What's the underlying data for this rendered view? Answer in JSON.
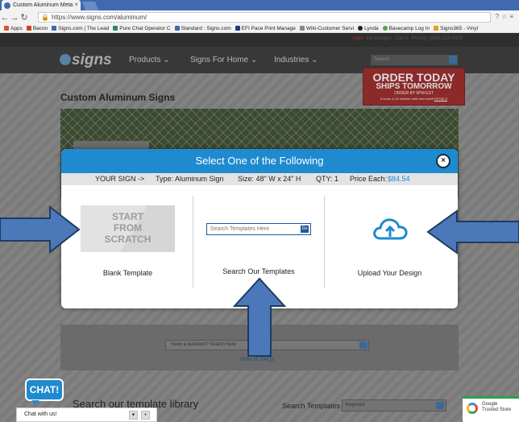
{
  "browser": {
    "tab_title": "Custom Aluminum Meta",
    "tab_close": "×",
    "url": "https://www.signs.com/aluminum/",
    "bookmarks": [
      "Apps",
      "Bacon",
      "Signs.com | The Lead",
      "Pure Chat Operator C",
      "Standard : Signs.com",
      "EFI Pace Print Manage",
      "Wiki-Customer Servi",
      "Lynda",
      "Basecamp Log In",
      "Signs365 - Vinyl"
    ]
  },
  "site": {
    "util_links": [
      "Login",
      "My Designs",
      "Cart 0",
      "Pricing",
      "(888) 222-4929"
    ],
    "logo": "signs",
    "nav": [
      "Products",
      "Signs For Home",
      "Industries"
    ],
    "search_placeholder": "Search",
    "promo": {
      "line1": "ORDER TODAY",
      "line2": "SHIPS TOMORROW",
      "line3": "ORDER BY 5PM EST",
      "line4": "6 hours & 26 minutes until next cutoff",
      "details": "DETAILS"
    },
    "page_title": "Custom Aluminum Signs",
    "faq_placeholder": "Have a question? Search here",
    "faq_link": "View all FAQs",
    "library_title": "Search our template library",
    "search_templates_label": "Search Templates",
    "search_templates_placeholder": "Keyword"
  },
  "modal": {
    "title": "Select One of the Following",
    "close": "×",
    "info": {
      "your_sign": "YOUR SIGN ->",
      "type": "Type: Aluminum Sign",
      "size": "Size: 48\" W x 24\" H",
      "qty": "QTY: 1",
      "price_label": "Price Each:",
      "price": "$84.54"
    },
    "blank_thumb_lines": [
      "START",
      "FROM",
      "SCRATCH"
    ],
    "blank_label": "Blank Template",
    "search_placeholder": "Search Templates Here",
    "search_go": "Go",
    "search_label": "Search Our Templates",
    "upload_label": "Upload Your Design"
  },
  "chat": {
    "bubble": "CHAT!",
    "bar_text": "Chat with us!",
    "minimize": "▾",
    "expand": "+"
  },
  "trusted": {
    "line1": "Google",
    "line2": "Trusted Store"
  },
  "colors": {
    "modal_blue": "#1e8ad0",
    "arrow_fill": "#4a78b8",
    "arrow_stroke": "#1f3b63"
  }
}
